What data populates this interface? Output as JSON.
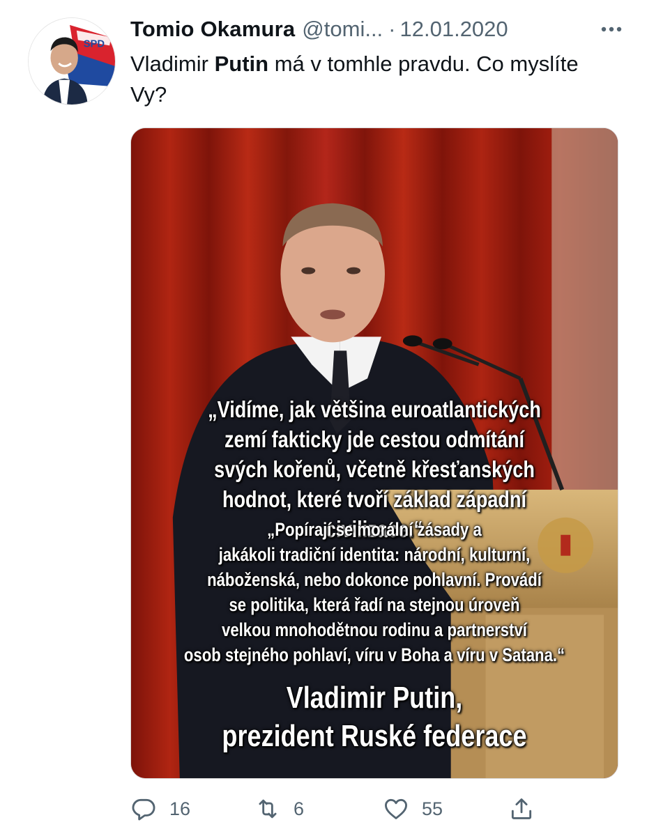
{
  "tweet": {
    "author_name": "Tomio Okamura",
    "author_handle": "@tomi...",
    "separator": "·",
    "date": "12.01.2020",
    "avatar_badge": "SPD",
    "text_before": "Vladimir ",
    "text_bold": "Putin",
    "text_after": " má v tomhle pravdu. Co myslíte Vy?"
  },
  "media": {
    "quote1_lines": [
      "„Vidíme, jak většina euroatlantických",
      "zemí fakticky jde cestou odmítání",
      "svých kořenů, včetně křesťanských",
      "hodnot, které tvoří základ západní civilizace.“"
    ],
    "quote2_lines": [
      "„Popírají se morální zásady a",
      "jakákoli tradiční identita: národní, kulturní,",
      "náboženská, nebo dokonce pohlavní. Provádí",
      "se politika, která řadí na stejnou úroveň",
      "velkou mnohodětnou rodinu a partnerství",
      "osob stejného pohlaví, víru v Boha a víru v Satana.“"
    ],
    "signature_lines": [
      "Vladimir Putin,",
      "prezident Ruské federace"
    ]
  },
  "actions": {
    "reply_count": "16",
    "retweet_count": "6",
    "like_count": "55"
  },
  "colors": {
    "text_primary": "#0f1419",
    "text_secondary": "#536471",
    "curtain_red": "#a3200f"
  },
  "icons": {
    "more": "more-icon",
    "reply": "reply-icon",
    "retweet": "retweet-icon",
    "like": "heart-icon",
    "share": "share-icon"
  }
}
